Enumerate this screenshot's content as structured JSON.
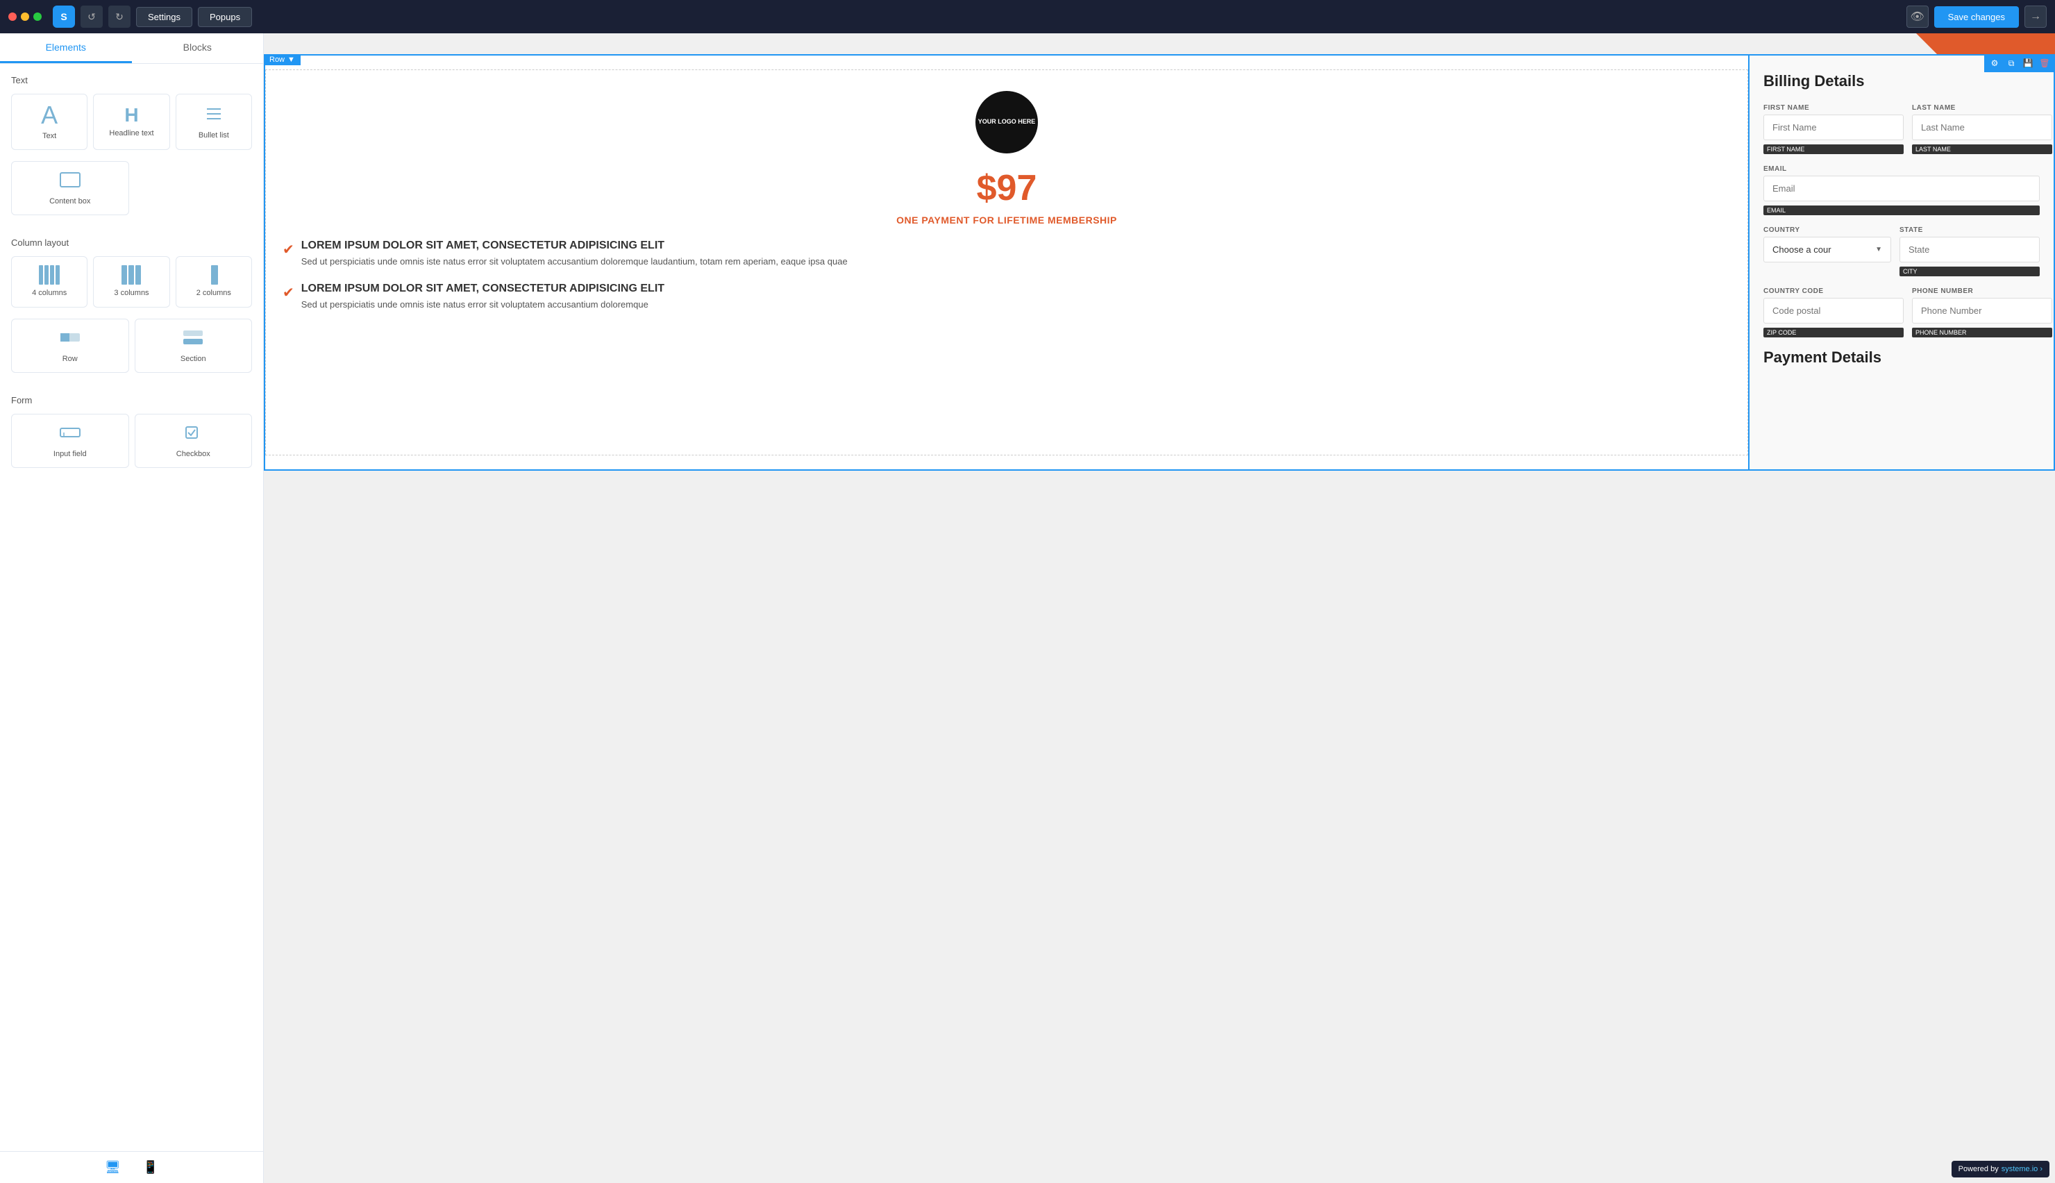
{
  "topbar": {
    "logo": "S",
    "undo_title": "Undo",
    "redo_title": "Redo",
    "settings_label": "Settings",
    "popups_label": "Popups",
    "save_label": "Save changes",
    "preview_icon": "👁",
    "exit_icon": "→"
  },
  "sidebar": {
    "tab_elements": "Elements",
    "tab_blocks": "Blocks",
    "text_section_label": "Text",
    "elements": [
      {
        "id": "text",
        "label": "Text",
        "icon": "A"
      },
      {
        "id": "headline",
        "label": "Headline text",
        "icon": "H"
      },
      {
        "id": "bullet",
        "label": "Bullet list",
        "icon": "≡"
      }
    ],
    "content_section_label": "",
    "content_elements": [
      {
        "id": "content-box",
        "label": "Content box",
        "icon": "□"
      }
    ],
    "column_section_label": "Column layout",
    "column_elements": [
      {
        "id": "4col",
        "label": "4 columns"
      },
      {
        "id": "3col",
        "label": "3 columns"
      },
      {
        "id": "2col",
        "label": "2 columns"
      }
    ],
    "row_section_label": "",
    "row_elements": [
      {
        "id": "row",
        "label": "Row"
      },
      {
        "id": "section",
        "label": "Section"
      }
    ],
    "form_section_label": "Form",
    "form_elements": [
      {
        "id": "input-field",
        "label": "Input field",
        "icon": "✏"
      },
      {
        "id": "checkbox",
        "label": "Checkbox",
        "icon": "☑"
      }
    ]
  },
  "canvas": {
    "row_label": "Row",
    "left_col": {
      "logo_text": "YOUR LOGO HERE",
      "price": "$97",
      "payment_text": "ONE PAYMENT FOR LIFETIME MEMBERSHIP",
      "feature1_title": "LOREM IPSUM DOLOR SIT AMET, CONSECTETUR ADIPISICING ELIT",
      "feature1_desc": "Sed ut perspiciatis unde omnis iste natus error sit voluptatem accusantium doloremque laudantium, totam rem aperiam, eaque ipsa quae",
      "feature2_title": "LOREM IPSUM DOLOR SIT AMET, CONSECTETUR ADIPISICING ELIT",
      "feature2_desc": "Sed ut perspiciatis unde omnis iste natus error sit voluptatem accusantium doloremque"
    },
    "right_col": {
      "billing_title": "Billing Details",
      "first_name_label": "FIRST NAME",
      "first_name_placeholder": "First Name",
      "first_name_tag": "FIRST NAME",
      "last_name_label": "LAST NAME",
      "last_name_placeholder": "Last Name",
      "last_name_tag": "LAST NAME",
      "email_label": "EMAIL",
      "email_placeholder": "Email",
      "email_tag": "EMAIL",
      "country_label": "COUNTRY",
      "country_placeholder": "Choose a cour",
      "state_label": "STATE",
      "state_placeholder": "State",
      "state_tag": "CITY",
      "country_code_label": "COUNTRY CODE",
      "country_code_placeholder": "Code postal",
      "country_code_tag": "ZIP CODE",
      "phone_label": "PHONE NUMBER",
      "phone_placeholder": "Phone Number",
      "phone_tag": "PHONE NUMBER",
      "payment_title": "Payment Details"
    }
  },
  "powered": {
    "text": "Powered by",
    "brand": "systeme.io ›"
  }
}
